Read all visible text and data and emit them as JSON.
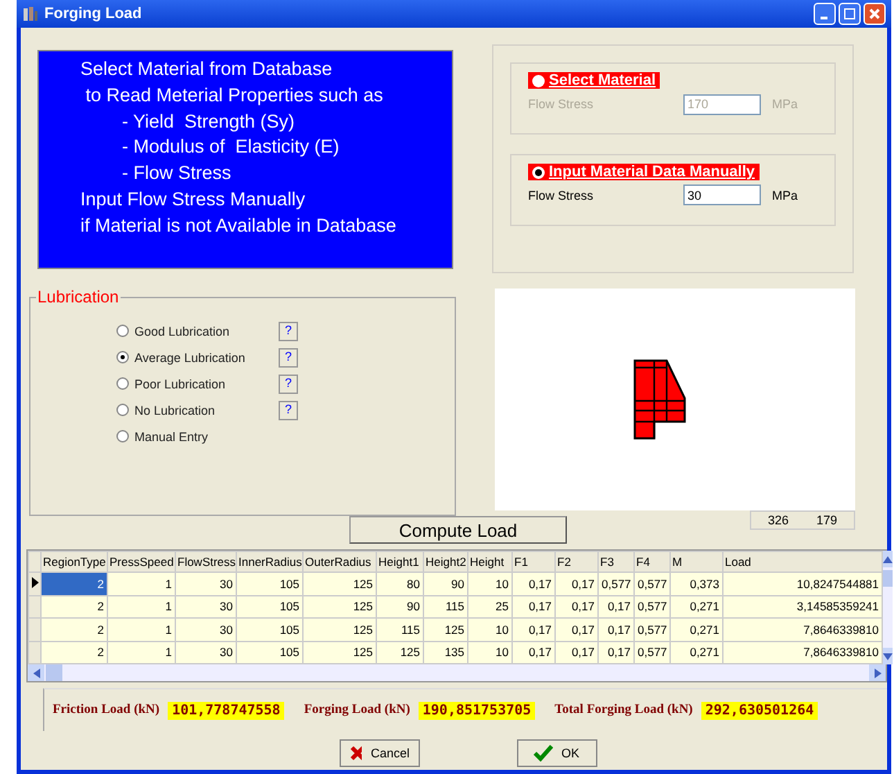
{
  "window": {
    "title": "Forging Load"
  },
  "info_lines": [
    "Select Material from Database",
    " to Read Meterial Properties such as",
    "        - Yield  Strength (Sy)",
    "        - Modulus of  Elasticity (E)",
    "        - Flow Stress",
    "Input Flow Stress Manually",
    "if Material is not Available in Database"
  ],
  "material_options": [
    {
      "label": "Select Material",
      "selected": false,
      "field_label": "Flow Stress",
      "value": "170",
      "unit": "MPa",
      "disabled": true
    },
    {
      "label": "Input Material Data Manually",
      "selected": true,
      "field_label": "Flow Stress",
      "value": "30",
      "unit": "MPa",
      "disabled": false
    }
  ],
  "lubrication": {
    "title": "Lubrication",
    "options": [
      {
        "label": "Good Lubrication",
        "selected": false,
        "help": "?"
      },
      {
        "label": "Average Lubrication",
        "selected": true,
        "help": "?"
      },
      {
        "label": "Poor Lubrication",
        "selected": false,
        "help": "?"
      },
      {
        "label": "No Lubrication",
        "selected": false,
        "help": "?"
      },
      {
        "label": "Manual Entry",
        "selected": false
      }
    ]
  },
  "canvas": {
    "status": [
      "326",
      "179"
    ]
  },
  "compute_button": "Compute Load",
  "table": {
    "columns": [
      "RegionType",
      "PressSpeed",
      "FlowStress",
      "InnerRadius",
      "OuterRadius",
      "Height1",
      "Height2",
      "Height",
      "F1",
      "F2",
      "F3",
      "F4",
      "M",
      "Load"
    ],
    "rows": [
      {
        "selected": true,
        "cells": [
          "2",
          "1",
          "30",
          "105",
          "125",
          "80",
          "90",
          "10",
          "0,17",
          "0,17",
          "0,577",
          "0,577",
          "0,373",
          "10,8247544881"
        ]
      },
      {
        "selected": false,
        "cells": [
          "2",
          "1",
          "30",
          "105",
          "125",
          "90",
          "115",
          "25",
          "0,17",
          "0,17",
          "0,17",
          "0,577",
          "0,271",
          "3,14585359241"
        ]
      },
      {
        "selected": false,
        "cells": [
          "2",
          "1",
          "30",
          "105",
          "125",
          "115",
          "125",
          "10",
          "0,17",
          "0,17",
          "0,17",
          "0,577",
          "0,271",
          "7,8646339810"
        ]
      },
      {
        "selected": false,
        "cells": [
          "2",
          "1",
          "30",
          "105",
          "125",
          "125",
          "135",
          "10",
          "0,17",
          "0,17",
          "0,17",
          "0,577",
          "0,271",
          "7,8646339810"
        ]
      }
    ]
  },
  "results": [
    {
      "label": "Friction Load (kN)",
      "value": "101,778747558"
    },
    {
      "label": "Forging Load (kN)",
      "value": "190,851753705"
    },
    {
      "label": "Total Forging Load (kN)",
      "value": "292,630501264"
    }
  ],
  "buttons": [
    {
      "kind": "cancel",
      "label": "Cancel"
    },
    {
      "kind": "ok",
      "label": "OK"
    }
  ]
}
